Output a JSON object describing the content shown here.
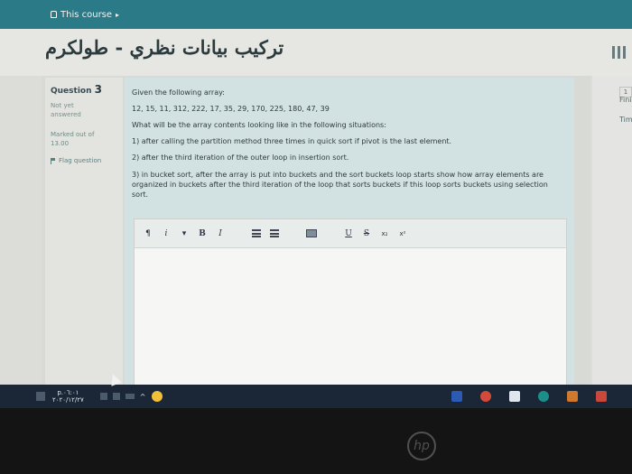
{
  "topbar": {
    "breadcrumb": "This course"
  },
  "header": {
    "course_title": "تركيب بيانات نظري - طولكرم"
  },
  "question_info": {
    "label": "Question",
    "number": "3",
    "state_line1": "Not yet",
    "state_line2": "answered",
    "grade_line1": "Marked out of",
    "grade_line2": "13.00",
    "flag_label": "Flag question"
  },
  "question": {
    "lines": [
      "Given the following array:",
      "12, 15, 11, 312, 222, 17, 35, 29, 170, 225, 180, 47, 39",
      "What will be the array contents looking like in the following situations:",
      "1) after calling the partition method three times in quick sort if pivot is the last element.",
      "2) after the third iteration of the outer loop in insertion sort.",
      "3) in bucket sort, after the array is put into buckets and the sort buckets loop starts show how array elements are organized in buckets after the third iteration of the loop that sorts buckets if this loop sorts buckets using selection sort."
    ]
  },
  "editor": {
    "toolbar": {
      "para": "¶",
      "info": "i",
      "bold": "B",
      "italic": "I",
      "underline": "U",
      "strike": "S",
      "subscript": "x₂",
      "superscript": "x²"
    },
    "value": ""
  },
  "right_panel": {
    "badge": "1",
    "text1": "Fini",
    "text2": "Tim"
  },
  "taskbar": {
    "time": "p.٠٦:٠١",
    "date": "٢٠٢٠/١٢/٢٧"
  },
  "bezel": {
    "logo": "hp"
  }
}
